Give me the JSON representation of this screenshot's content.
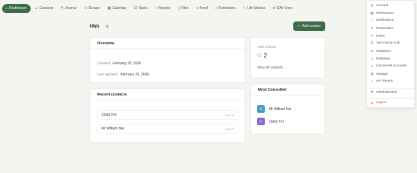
{
  "nav": {
    "items": [
      {
        "label": "Dashboard",
        "icon": "home-icon",
        "active": true
      },
      {
        "label": "Contacts",
        "icon": "contacts-icon"
      },
      {
        "label": "Journal",
        "icon": "pen-icon"
      },
      {
        "label": "Groups",
        "icon": "groups-icon"
      },
      {
        "label": "Calendar",
        "icon": "calendar-icon"
      },
      {
        "label": "Tasks",
        "icon": "tasks-icon"
      },
      {
        "label": "Reports",
        "icon": "reports-icon"
      },
      {
        "label": "Files",
        "icon": "file-icon"
      },
      {
        "label": "Feed",
        "icon": "feed-icon"
      },
      {
        "label": "Reminders",
        "icon": "bell-icon"
      },
      {
        "label": "Life Metrics",
        "icon": "heart-icon"
      },
      {
        "label": "DAV Sync",
        "icon": "sync-icon"
      }
    ]
  },
  "page": {
    "title": "Hhh",
    "add_contact_label": "Add contact"
  },
  "overview": {
    "title": "Overview",
    "created_label": "Created:",
    "created_value": "February 25, 2026",
    "updated_label": "Last updated:",
    "updated_value": "February 25, 2026"
  },
  "totals": {
    "label": "Total contacts",
    "count": "2",
    "view_all": "View all contacts →"
  },
  "recent": {
    "title": "Recent contacts",
    "rows": [
      {
        "name": "Qqqq Xxx",
        "date": "Feb 25"
      },
      {
        "name": "Mr William Nai",
        "date": "Feb 25"
      }
    ]
  },
  "consulted": {
    "title": "Most Consulted",
    "rows": [
      {
        "name": "Mr William Nai",
        "color": "#4a9fc4"
      },
      {
        "name": "Qqqq Xxx",
        "color": "#8a6cc4"
      }
    ]
  },
  "menu": {
    "items": [
      {
        "label": "Account",
        "icon": "user-icon"
      },
      {
        "label": "Preferences",
        "icon": "sliders-icon"
      },
      {
        "label": "Notifications",
        "icon": "bell-icon"
      },
      {
        "label": "Personalize",
        "icon": "brush-icon"
      },
      {
        "label": "Users",
        "icon": "users-icon"
      },
      {
        "label": "Two-Factor Auth",
        "icon": "shield-icon"
      },
      {
        "label": "Invitations",
        "icon": "mail-icon"
      },
      {
        "label": "Passkeys",
        "icon": "key-icon"
      },
      {
        "label": "Connected Accounts",
        "icon": "link-icon"
      },
      {
        "label": "Storage",
        "icon": "database-icon"
      },
      {
        "label": "API Tokens",
        "icon": "code-icon"
      },
      {
        "label": "Administration",
        "icon": "gear-icon"
      },
      {
        "label": "Logout",
        "icon": "logout-icon"
      }
    ]
  },
  "colors": {
    "accent": "#3e6b4a",
    "logout": "#c84a4a",
    "background": "#f3f5f1"
  }
}
